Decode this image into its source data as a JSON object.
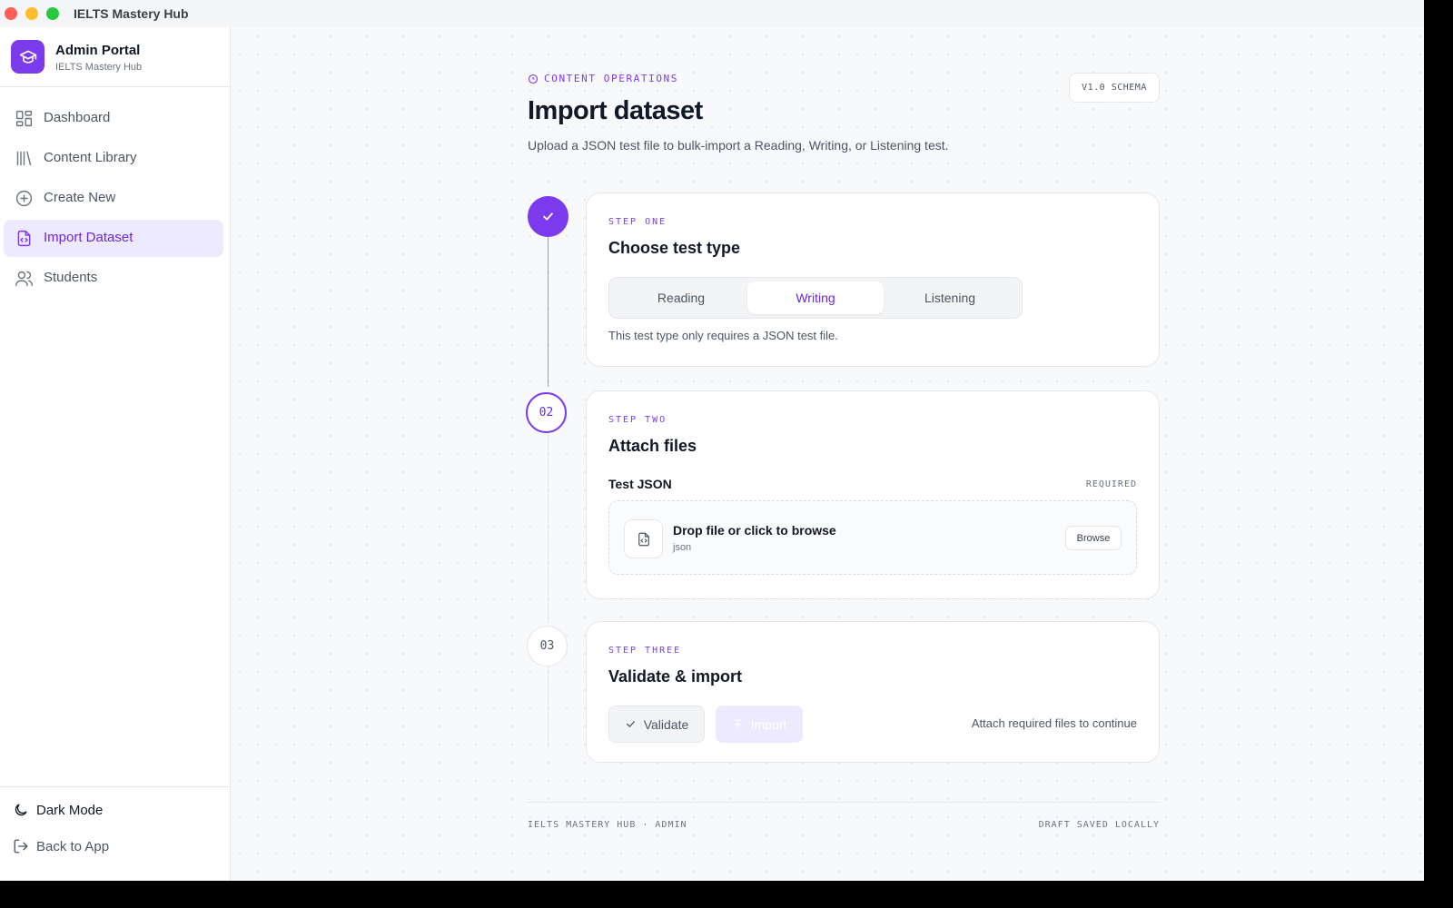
{
  "window": {
    "title": "IELTS Mastery Hub"
  },
  "brand": {
    "name": "Admin Portal",
    "subtitle": "IELTS Mastery Hub"
  },
  "sidebar": {
    "items": [
      {
        "label": "Dashboard",
        "icon": "dashboard-icon"
      },
      {
        "label": "Content Library",
        "icon": "library-icon"
      },
      {
        "label": "Create New",
        "icon": "plus-circle-icon"
      },
      {
        "label": "Import Dataset",
        "icon": "file-code-icon",
        "active": true
      },
      {
        "label": "Students",
        "icon": "users-icon"
      }
    ],
    "dark_mode": "Dark Mode",
    "back_to_app": "Back to App"
  },
  "header": {
    "eyebrow": "CONTENT OPERATIONS",
    "title": "Import dataset",
    "description": "Upload a JSON test file to bulk-import a Reading, Writing, or Listening test.",
    "schema_badge": "V1.0 SCHEMA"
  },
  "steps": {
    "one": {
      "label": "STEP ONE",
      "title": "Choose test type",
      "options": [
        "Reading",
        "Writing",
        "Listening"
      ],
      "selected": "Writing",
      "hint": "This test type only requires a JSON test file."
    },
    "two": {
      "number": "02",
      "label": "STEP TWO",
      "title": "Attach files",
      "field_label": "Test JSON",
      "required": "REQUIRED",
      "dropzone_title": "Drop file or click to browse",
      "dropzone_sub": "json",
      "browse": "Browse"
    },
    "three": {
      "number": "03",
      "label": "STEP THREE",
      "title": "Validate & import",
      "validate": "Validate",
      "import": "Import",
      "hint": "Attach required files to continue"
    }
  },
  "footer": {
    "left": "IELTS MASTERY HUB · ADMIN",
    "right": "DRAFT SAVED LOCALLY"
  },
  "colors": {
    "accent": "#7c3aed",
    "accent_soft": "#ede9fe"
  }
}
